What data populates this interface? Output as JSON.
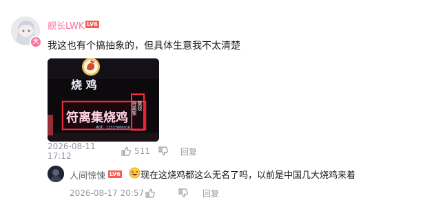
{
  "comment": {
    "username": "舰长LWK",
    "level_badge": "LV6",
    "vip_badge": "大",
    "text": "我这也有个搞抽象的，但具体生意我不太清楚",
    "photo": {
      "sign_top": "烧 鸡",
      "sign_main": "符离集烧鸡",
      "sign_side": "符离集",
      "sign_side2": "集烧",
      "sign_phone": "电话：13537866916"
    },
    "time": "2026-08-11 17:12",
    "like_count": "511",
    "reply_label": "回复"
  },
  "reply": {
    "username": "人间惊悚",
    "level_badge": "LV6",
    "text": "现在这烧鸡都这么无名了吗，以前是中国几大烧鸡来着",
    "time": "2026-08-17 20:57",
    "reply_label": "回复"
  },
  "icons": {
    "like": "thumbs-up-icon",
    "dislike": "thumbs-down-icon",
    "emoji": "laughing-emoji-icon"
  },
  "colors": {
    "username_vip": "#fb7299",
    "level_badge": "#f85a54",
    "meta_text": "#9499a0",
    "neon_red": "#ff2a3c"
  }
}
